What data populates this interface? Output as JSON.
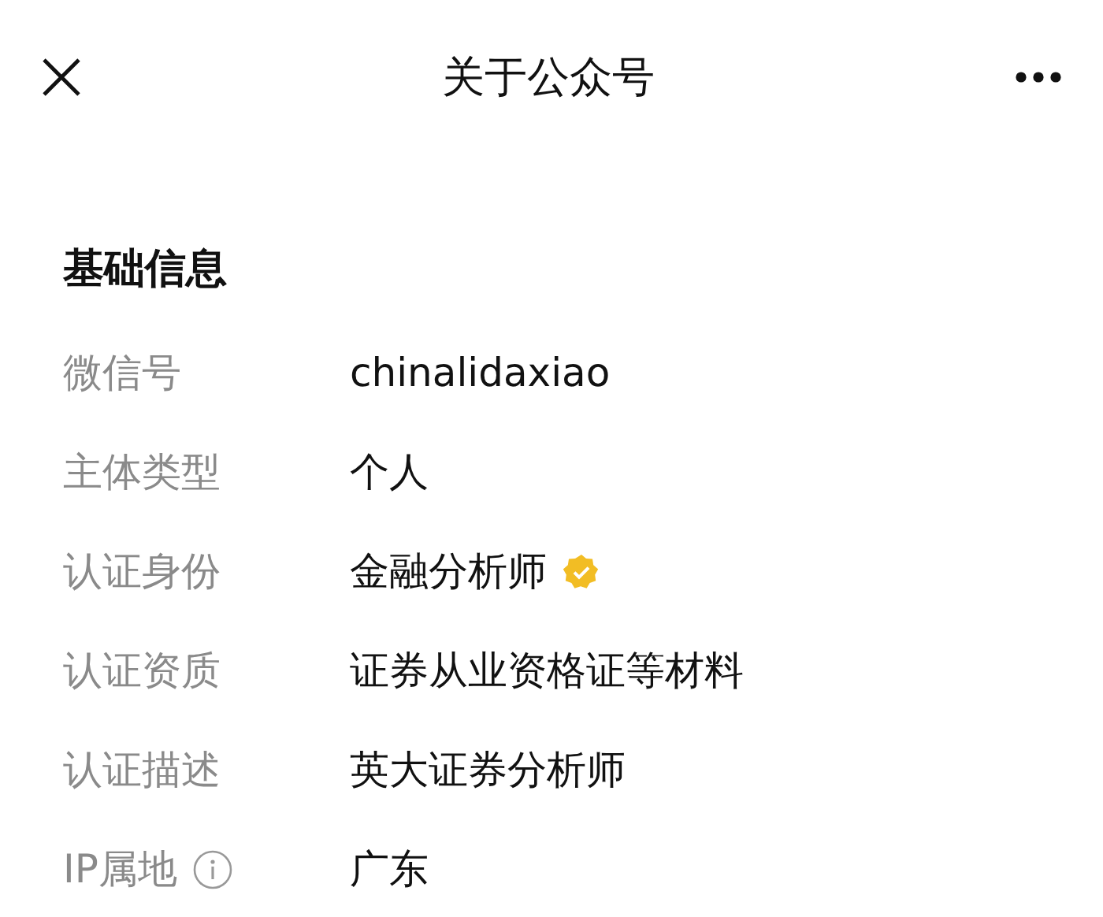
{
  "header": {
    "title": "关于公众号"
  },
  "section": {
    "title": "基础信息",
    "rows": [
      {
        "label": "微信号",
        "value": "chinalidaxiao",
        "verified": false,
        "info": false
      },
      {
        "label": "主体类型",
        "value": "个人",
        "verified": false,
        "info": false
      },
      {
        "label": "认证身份",
        "value": "金融分析师",
        "verified": true,
        "info": false
      },
      {
        "label": "认证资质",
        "value": "证券从业资格证等材料",
        "verified": false,
        "info": false
      },
      {
        "label": "认证描述",
        "value": "英大证券分析师",
        "verified": false,
        "info": false
      },
      {
        "label": "IP属地",
        "value": "广东",
        "verified": false,
        "info": true
      }
    ]
  }
}
